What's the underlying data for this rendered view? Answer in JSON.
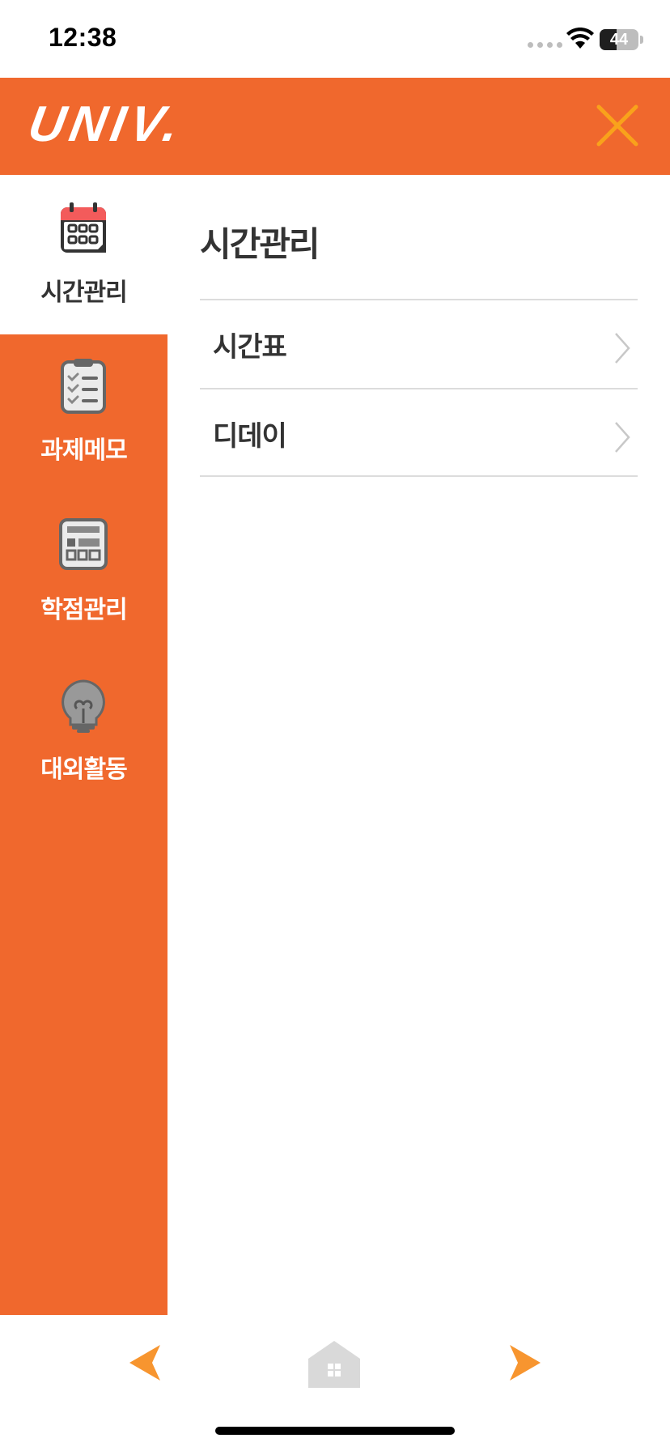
{
  "status_bar": {
    "time": "12:38",
    "battery": "44",
    "battery_level": 0.44
  },
  "header": {
    "logo": "UNIV.",
    "close_icon": "close-icon",
    "accent_color": "#f0682d",
    "close_color": "#f9a21b"
  },
  "sidebar": {
    "items": [
      {
        "label": "시간관리",
        "icon": "calendar-icon",
        "active": true
      },
      {
        "label": "과제메모",
        "icon": "clipboard-checklist-icon",
        "active": false
      },
      {
        "label": "학점관리",
        "icon": "calculator-icon",
        "active": false
      },
      {
        "label": "대외활동",
        "icon": "lightbulb-icon",
        "active": false
      }
    ]
  },
  "main": {
    "title": "시간관리",
    "items": [
      {
        "label": "시간표"
      },
      {
        "label": "디데이"
      }
    ]
  },
  "bottom_nav": {
    "back_icon": "back-arrow-icon",
    "home_icon": "home-icon",
    "forward_icon": "forward-arrow-icon"
  }
}
